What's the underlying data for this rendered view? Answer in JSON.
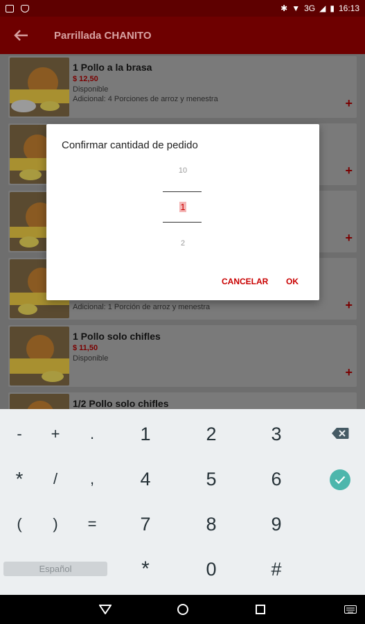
{
  "status_bar": {
    "network": "3G",
    "time": "16:13"
  },
  "app_bar": {
    "title": "Parrillada CHANITO"
  },
  "products": [
    {
      "name": "1 Pollo a la brasa",
      "price": "$ 12,50",
      "status": "Disponible",
      "extra": "Adicional: 4 Porciones de arroz y menestra"
    },
    {
      "name": "",
      "price": "",
      "status": "",
      "extra": ""
    },
    {
      "name": "",
      "price": "",
      "status": "",
      "extra": ""
    },
    {
      "name": "",
      "price": "",
      "status": "",
      "extra": "Adicional: 1 Porción de arroz y menestra"
    },
    {
      "name": "1 Pollo solo chifles",
      "price": "$ 11,50",
      "status": "Disponible",
      "extra": ""
    },
    {
      "name": "1/2 Pollo solo chifles",
      "price": "",
      "status": "",
      "extra": ""
    }
  ],
  "add_symbol": "+",
  "dialog": {
    "title": "Confirmar cantidad de pedido",
    "picker_prev": "10",
    "picker_current": "1",
    "picker_next": "2",
    "cancel_label": "CANCELAR",
    "ok_label": "OK"
  },
  "keyboard": {
    "row1": [
      "-",
      "+",
      ".",
      "1",
      "2",
      "3"
    ],
    "row2": [
      "*",
      "/",
      ",",
      "4",
      "5",
      "6"
    ],
    "row3": [
      "(",
      ")",
      "=",
      "7",
      "8",
      "9"
    ],
    "row4": [
      "*",
      "0",
      "#"
    ],
    "language": "Español",
    "delete_icon": "backspace-icon",
    "enter_icon": "check-icon"
  },
  "colors": {
    "primary": "#6e0000",
    "accent": "#c90000",
    "enter": "#4db6ac"
  }
}
